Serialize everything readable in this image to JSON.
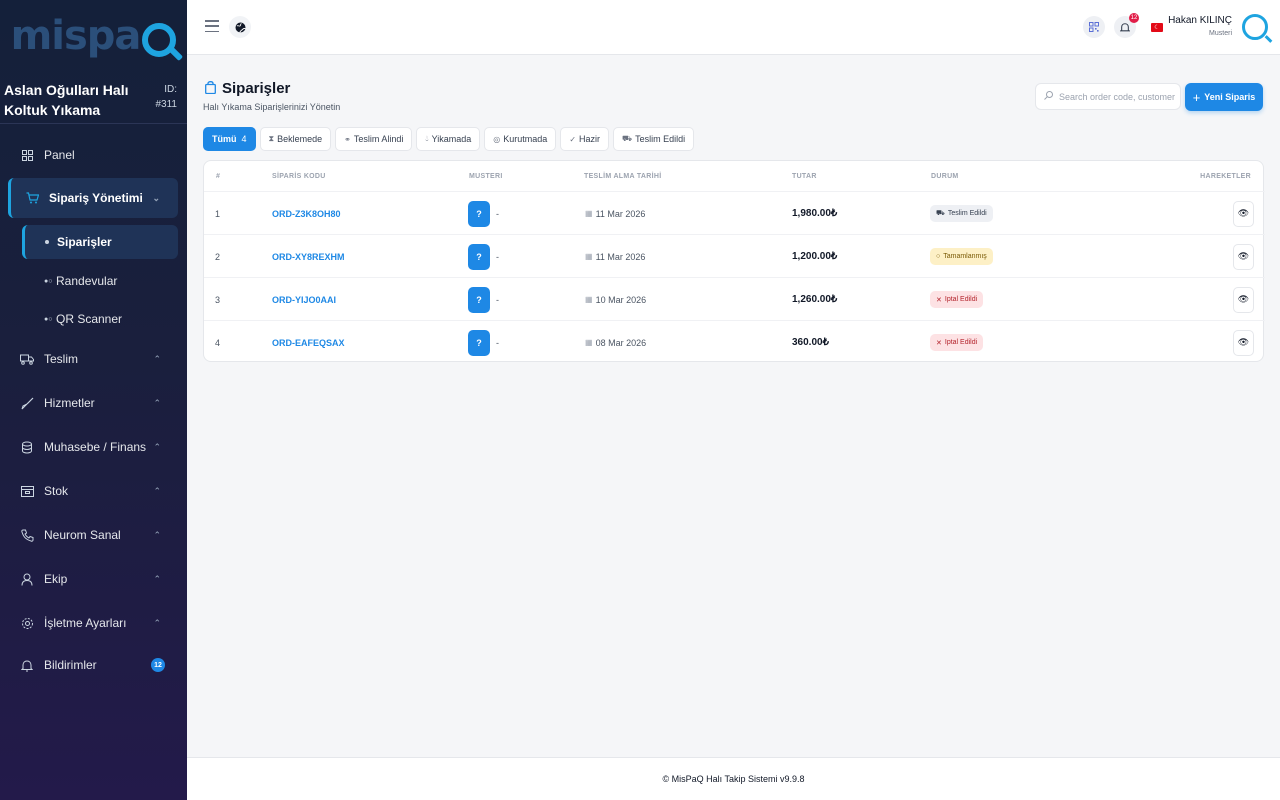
{
  "brand": {
    "logo_text": "mispa",
    "accent": "#1ea4e0"
  },
  "company": {
    "name": "Aslan Oğulları Halı Koltuk Yıkama",
    "id_label": "ID:",
    "id_value": "#311"
  },
  "sidebar": {
    "panel": "Panel",
    "order_mgmt": "Sipariş Yönetimi",
    "sub_orders": "Siparişler",
    "sub_appointments": "Randevular",
    "sub_qr": "QR Scanner",
    "delivery": "Teslim",
    "services": "Hizmetler",
    "finance": "Muhasebe / Finans",
    "stock": "Stok",
    "neurom": "Neurom Sanal",
    "team": "Ekip",
    "settings": "İşletme Ayarları",
    "notifications": "Bildirimler",
    "notifications_count": "12"
  },
  "topbar": {
    "bell_count": "12",
    "user_name": "Hakan KILINÇ",
    "user_role": "Musteri"
  },
  "page": {
    "title": "Siparişler",
    "subtitle": "Halı Yıkama Siparişlerinizi Yönetin",
    "search_placeholder": "Search order code, customer",
    "new_button": "Yeni Siparis"
  },
  "filters": {
    "all": "Tümü",
    "all_count": "4",
    "waiting": "Beklemede",
    "received": "Teslim Alindi",
    "washing": "Yikamada",
    "drying": "Kurutmada",
    "ready": "Hazir",
    "delivered": "Teslim Edildi"
  },
  "table": {
    "headers": {
      "num": "#",
      "code": "SİPARİS KODU",
      "customer": "MUSTERI",
      "date": "TESLİM ALMA TARİHİ",
      "amount": "TUTAR",
      "status": "DURUM",
      "actions": "HAREKETLER"
    },
    "rows": [
      {
        "num": "1",
        "code": "ORD-Z3K8OH80",
        "customer_badge": "?",
        "customer": "-",
        "date": "11 Mar 2026",
        "amount": "1,980.00₺",
        "status": "Teslim Edildi",
        "status_type": "delivered"
      },
      {
        "num": "2",
        "code": "ORD-XY8REXHM",
        "customer_badge": "?",
        "customer": "-",
        "date": "11 Mar 2026",
        "amount": "1,200.00₺",
        "status": "Tamamlanmış",
        "status_type": "completed"
      },
      {
        "num": "3",
        "code": "ORD-YIJO0AAI",
        "customer_badge": "?",
        "customer": "-",
        "date": "10 Mar 2026",
        "amount": "1,260.00₺",
        "status": "Iptal Edildi",
        "status_type": "cancelled"
      },
      {
        "num": "4",
        "code": "ORD-EAFEQSAX",
        "customer_badge": "?",
        "customer": "-",
        "date": "08 Mar 2026",
        "amount": "360.00₺",
        "status": "Iptal Edildi",
        "status_type": "cancelled"
      }
    ]
  },
  "footer": {
    "text": "© MisPaQ Halı Takip Sistemi v9.9.8"
  }
}
